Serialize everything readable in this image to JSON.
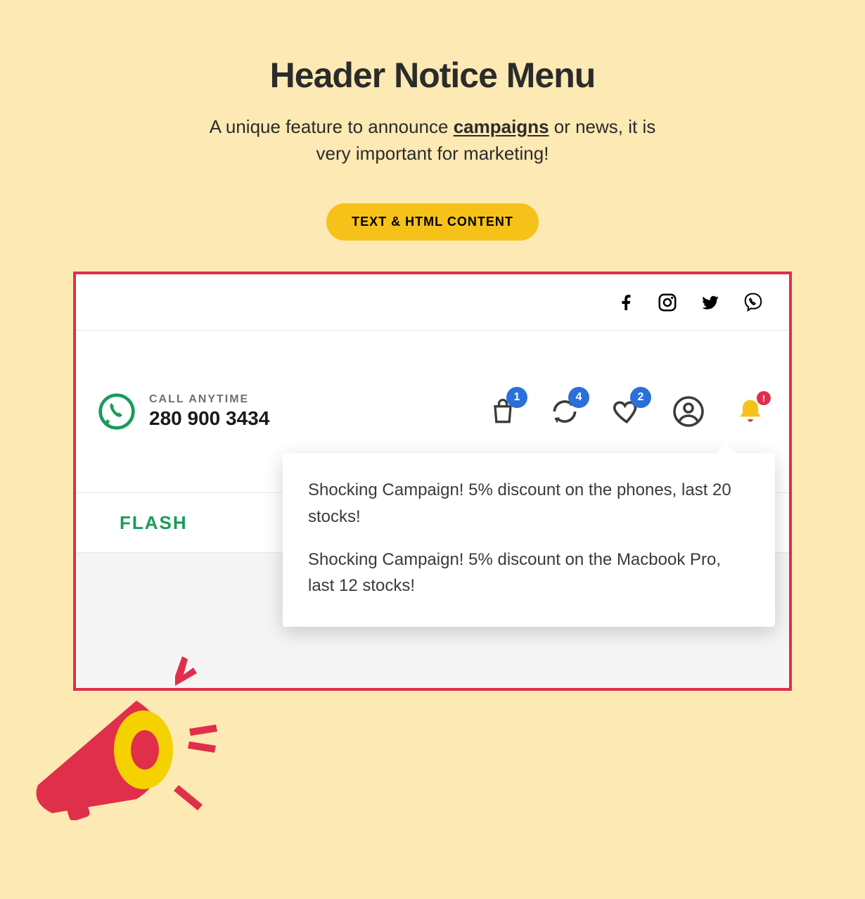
{
  "heading": "Header Notice Menu",
  "subtitle_pre": "A unique feature to announce ",
  "subtitle_underline": "campaigns",
  "subtitle_post": " or news, it is very important for marketing!",
  "pill_label": "TEXT & HTML CONTENT",
  "call": {
    "label": "CALL ANYTIME",
    "number": "280 900 3434"
  },
  "badges": {
    "cart": "1",
    "compare": "4",
    "wishlist": "2"
  },
  "bell_alert": "!",
  "flash_label": "FLASH",
  "notices": [
    "Shocking Campaign! 5% discount on the phones, last 20 stocks!",
    "Shocking Campaign! 5% discount on the Macbook Pro, last 12 stocks!"
  ]
}
